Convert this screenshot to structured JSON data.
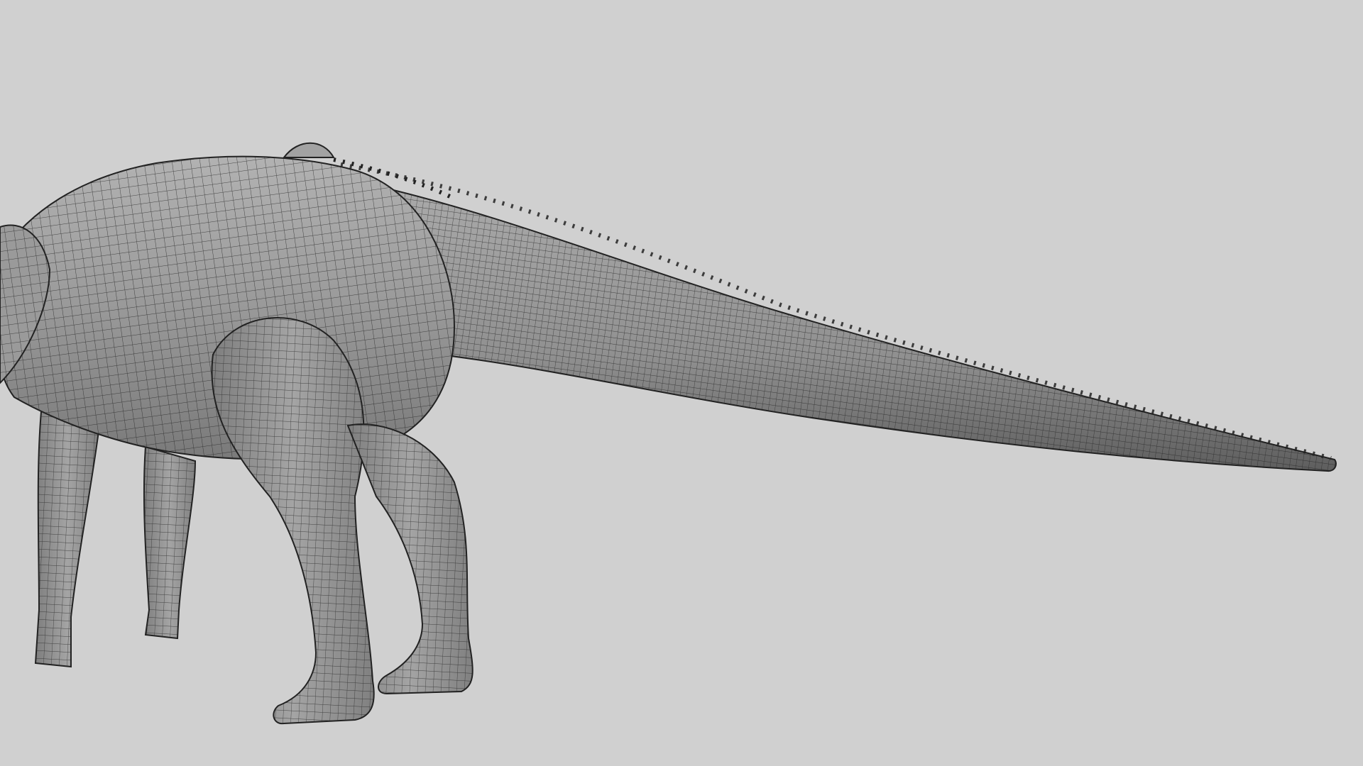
{
  "viewport": {
    "background_color": "#d0d0d0",
    "subject": "dinosaur-mesh",
    "mesh_fill": "#8e8e8e",
    "mesh_wire_color": "#2a2a2a",
    "shadow_color": "#6a6a6a",
    "highlight_color": "#b4b4b4",
    "display_mode": "wireframe-on-shaded"
  }
}
